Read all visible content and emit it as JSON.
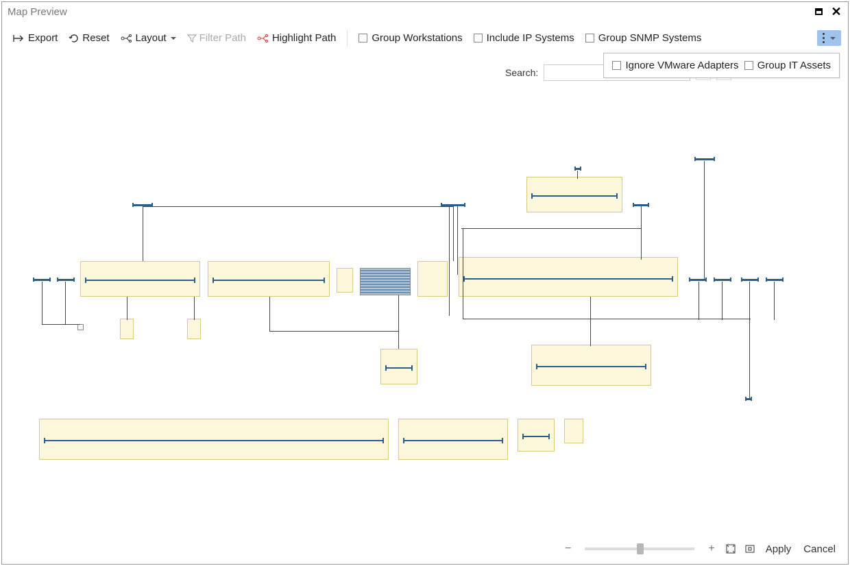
{
  "window": {
    "title": "Map Preview"
  },
  "toolbar": {
    "export": "Export",
    "reset": "Reset",
    "layout": "Layout",
    "filter_path": "Filter Path",
    "highlight_path": "Highlight Path",
    "group_workstations": "Group Workstations",
    "include_ip_systems": "Include IP Systems",
    "group_snmp_systems": "Group SNMP Systems"
  },
  "overflow_menu": {
    "ignore_vmware_adapters": "Ignore VMware Adapters",
    "group_it_assets": "Group IT Assets"
  },
  "search": {
    "label": "Search:",
    "value": ""
  },
  "footer": {
    "apply": "Apply",
    "cancel": "Cancel"
  }
}
